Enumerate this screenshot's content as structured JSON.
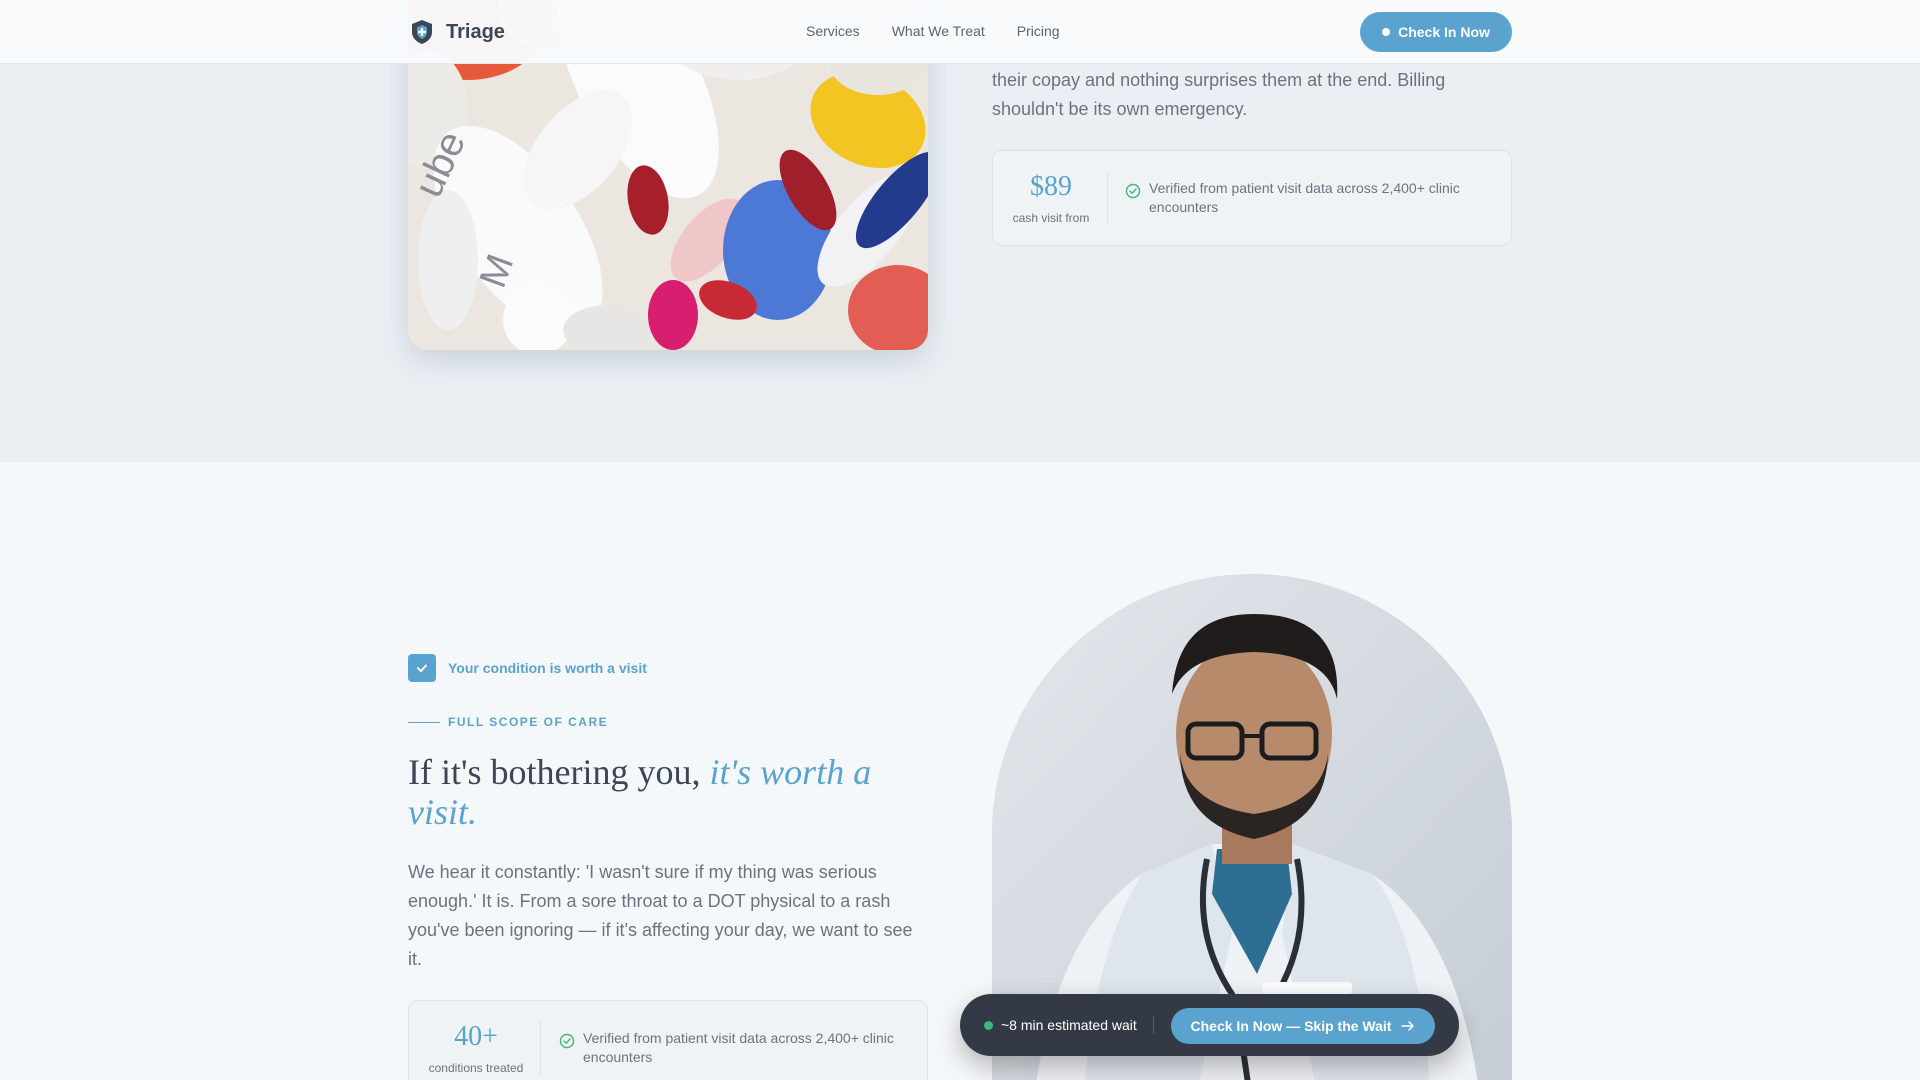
{
  "header": {
    "brand": "Triage",
    "nav": [
      "Services",
      "What We Treat",
      "Pricing"
    ],
    "cta": "Check In Now"
  },
  "pricing_section": {
    "text": "their copay and nothing surprises them at the end. Billing shouldn't be its own emergency.",
    "stat": {
      "value": "$89",
      "caption": "cash visit from",
      "note": "Verified from patient visit data across 2,400+ clinic encounters"
    }
  },
  "scope_section": {
    "chip": "Your condition is worth a visit",
    "eyebrow": "FULL SCOPE OF CARE",
    "headline_plain": "If it's bothering you, ",
    "headline_emphasis": "it's worth a visit.",
    "body": "We hear it constantly: 'I wasn't sure if my thing was serious enough.' It is. From a sore throat to a DOT physical to a rash you've been ignoring — if it's affecting your day, we want to see it.",
    "stat": {
      "value": "40+",
      "caption": "conditions treated",
      "note": "Verified from patient visit data across 2,400+ clinic encounters"
    }
  },
  "wait_bar": {
    "status": "~8 min estimated wait",
    "cta": "Check In Now — Skip the Wait"
  },
  "colors": {
    "accent": "#5aa3cf",
    "verified": "#3cb878",
    "heading": "#3c4656",
    "waitbar_bg": "#333a45"
  }
}
